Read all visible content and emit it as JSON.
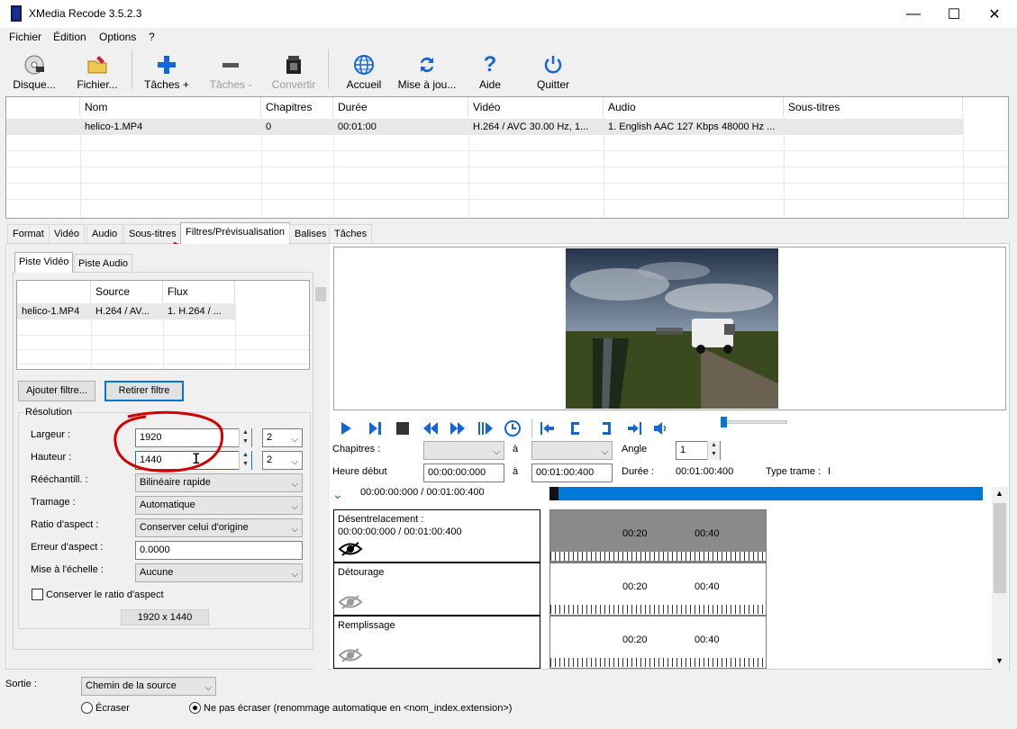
{
  "window": {
    "title": "XMedia Recode 3.5.2.3",
    "min": "—",
    "max": "☐",
    "close": "✕"
  },
  "menu": [
    "Fichier",
    "Édition",
    "Options",
    "?"
  ],
  "toolbar": [
    {
      "label": "Disque...",
      "icon": "disc-icon",
      "enabled": true
    },
    {
      "label": "Fichier...",
      "icon": "open-file-icon",
      "enabled": true
    },
    {
      "label": "Tâches +",
      "icon": "add-icon",
      "enabled": true
    },
    {
      "label": "Tâches -",
      "icon": "remove-icon",
      "enabled": false
    },
    {
      "label": "Convertir",
      "icon": "convert-icon",
      "enabled": false
    },
    {
      "label": "Accueil",
      "icon": "globe-icon",
      "enabled": true
    },
    {
      "label": "Mise à jou...",
      "icon": "refresh-icon",
      "enabled": true
    },
    {
      "label": "Aide",
      "icon": "help-icon",
      "enabled": true
    },
    {
      "label": "Quitter",
      "icon": "power-icon",
      "enabled": true
    }
  ],
  "filetable": {
    "headers": [
      "Nom",
      "Chapitres",
      "Durée",
      "Vidéo",
      "Audio",
      "Sous-titres"
    ],
    "rows": [
      [
        "helico-1.MP4",
        "0",
        "00:01:00",
        "H.264 / AVC  30.00 Hz, 1...",
        "1. English AAC  127 Kbps 48000 Hz ...",
        ""
      ]
    ]
  },
  "tabs": [
    "Format",
    "Vidéo",
    "Audio",
    "Sous-titres",
    "Filtres/Prévisualisation",
    "Balises",
    "Tâches"
  ],
  "active_tab": "Filtres/Prévisualisation",
  "subtabs": [
    "Piste Vidéo",
    "Piste Audio"
  ],
  "tracktable": {
    "headers": [
      "",
      "Source",
      "Flux"
    ],
    "rows": [
      [
        "helico-1.MP4",
        "H.264 / AV...",
        "1. H.264 / ..."
      ]
    ]
  },
  "buttons": {
    "add_filter": "Ajouter filtre...",
    "remove_filter": "Retirer filtre"
  },
  "resolution": {
    "group_title": "Résolution",
    "width_label": "Largeur :",
    "width_value": "1920",
    "width_mult": "2",
    "height_label": "Hauteur :",
    "height_value": "1440",
    "height_mult": "2",
    "resample_label": "Rééchantill. :",
    "resample_value": "Bilinéaire rapide",
    "dither_label": "Tramage :",
    "dither_value": "Automatique",
    "aspect_label": "Ratio d'aspect :",
    "aspect_value": "Conserver celui d'origine",
    "aspect_error_label": "Erreur d'aspect :",
    "aspect_error_value": "0.0000",
    "scale_label": "Mise à l'échelle :",
    "scale_value": "Aucune",
    "keep_ratio_label": "Conserver le ratio d'aspect",
    "keep_ratio_checked": false,
    "result": "1920 x 1440"
  },
  "playback": {
    "chapters_label": "Chapitres :",
    "to": "à",
    "angle_label": "Angle",
    "angle_value": "1",
    "start_label": "Heure début",
    "start_value": "00:00:00:000",
    "end_value": "00:01:00:400",
    "duration_label": "Durée :",
    "duration_value": "00:01:00:400",
    "frame_type_label": "Type trame :",
    "frame_type_value": "I",
    "position": "00:00:00:000 / 00:01:00:400",
    "progress_fraction": 1.0
  },
  "filters": [
    {
      "name": "Désentrelacement :",
      "time": "00:00:00:000 / 00:01:00:400",
      "enabled": true
    },
    {
      "name": "Détourage",
      "time": "",
      "enabled": false
    },
    {
      "name": "Remplissage",
      "time": "",
      "enabled": false
    }
  ],
  "timeline_marks": [
    "00:20",
    "00:40"
  ],
  "output": {
    "label": "Sortie :",
    "value": "Chemin de la source",
    "overwrite": "Écraser",
    "no_overwrite": "Ne pas écraser (renommage automatique en <nom_index.extension>)",
    "selected": "no_overwrite"
  }
}
